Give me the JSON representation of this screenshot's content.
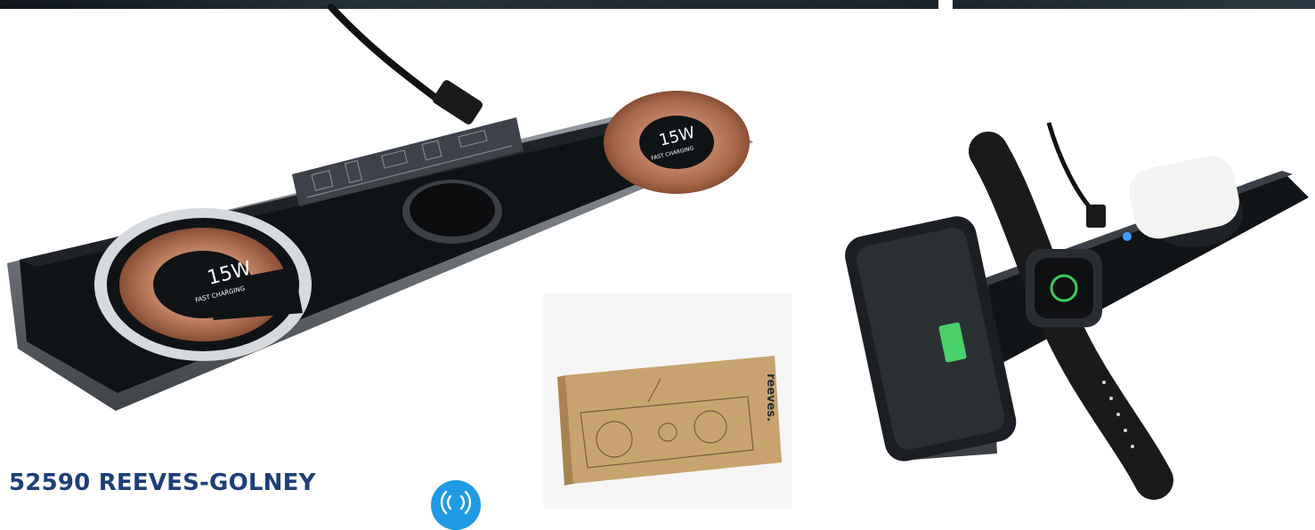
{
  "product": {
    "title": "52590 REEVES-GOLNEY"
  },
  "main_charger": {
    "left_pad_label": "15W",
    "left_pad_sublabel": "FAST CHARGING",
    "right_pad_label": "15W",
    "right_pad_sublabel": "FAST CHARGING"
  },
  "packaging": {
    "brand": "reeves."
  },
  "icons": {
    "badge": "wireless-charging-icon"
  },
  "colors": {
    "title": "#1f3e7a",
    "badge": "#1e9be3",
    "copper": "#c98b6b",
    "charger_body": "#101316"
  }
}
